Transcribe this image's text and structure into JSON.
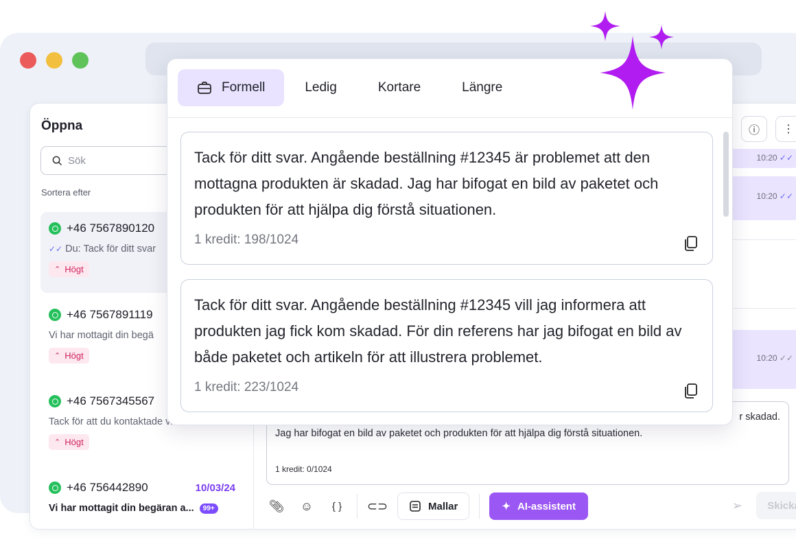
{
  "sidebar": {
    "title": "Öppna",
    "search_placeholder": "Sök",
    "sort_label": "Sortera efter",
    "conversations": [
      {
        "phone": "+46 7567890120",
        "preview": "Du: Tack för ditt svar",
        "priority": "Högt"
      },
      {
        "phone": "+46 7567891119",
        "preview": "Vi har mottagit din begä",
        "priority": "Högt"
      },
      {
        "phone": "+46 7567345567",
        "preview": "Tack för att du kontaktade vi...",
        "priority": "Högt"
      },
      {
        "phone": "+46 756442890",
        "date": "10/03/24",
        "preview": "Vi har mottagit din begäran a...",
        "badge": "99+"
      }
    ]
  },
  "chat": {
    "times": [
      "10:20",
      "10:20",
      "10:20"
    ]
  },
  "composer": {
    "text_line1": "r skadad.",
    "text_line2": "Jag har bifogat en bild av paketet och produkten för att hjälpa dig förstå situationen.",
    "credits": "1 kredit: 0/1024"
  },
  "toolbar": {
    "templates_label": "Mallar",
    "ai_label": "AI-assistent",
    "send_label": "Skicka"
  },
  "popup": {
    "tabs": [
      "Formell",
      "Ledig",
      "Kortare",
      "Längre"
    ],
    "suggestions": [
      {
        "text": "Tack för ditt svar. Angående beställning #12345 är problemet att den mottagna produkten är skadad. Jag har bifogat en bild av paketet och produkten för att hjälpa dig förstå situationen.",
        "credit": "1 kredit: 198/1024"
      },
      {
        "text": "Tack för ditt svar. Angående beställning #12345 vill jag informera att produkten jag fick kom skadad. För din referens har jag bifogat en bild av både paketet och artikeln för att illustrera problemet.",
        "credit": "1 kredit: 223/1024"
      }
    ]
  },
  "colors": {
    "accent": "#9b57f3",
    "sparkle": "#b11cf0",
    "priority": "#d0245d"
  }
}
